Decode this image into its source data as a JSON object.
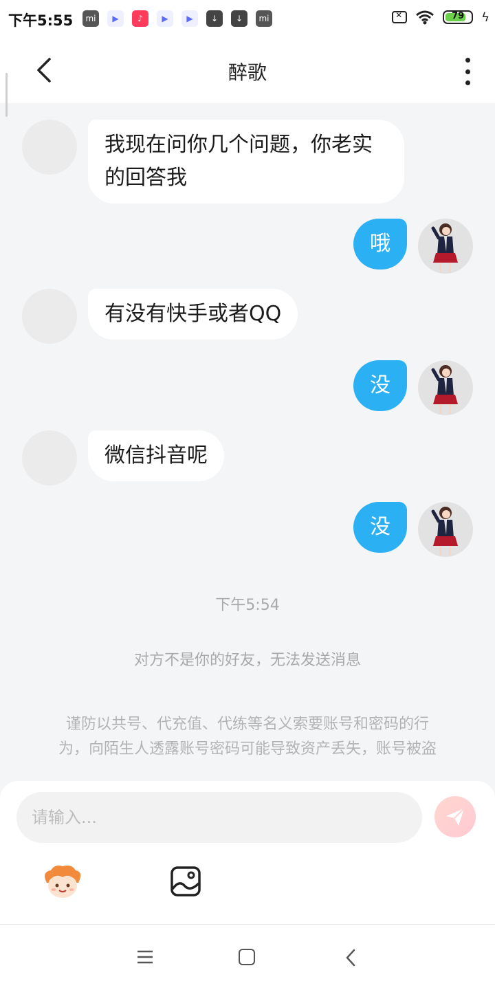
{
  "status_bar": {
    "time": "下午5:55",
    "app_icons": [
      "mi-icon",
      "video-play-icon",
      "tiktok-icon",
      "video-play-icon",
      "video-play-icon",
      "download-icon",
      "download-icon",
      "mi-icon"
    ],
    "mi_label": "mi",
    "battery_level": "79",
    "battery_fraction": 0.79
  },
  "header": {
    "title": "醉歌"
  },
  "messages": [
    {
      "side": "in",
      "text": "我现在问你几个问题，你老实的回答我"
    },
    {
      "side": "out",
      "text": "哦"
    },
    {
      "side": "in",
      "text": "有没有快手或者QQ"
    },
    {
      "side": "out",
      "text": "没"
    },
    {
      "side": "in",
      "text": "微信抖音呢"
    },
    {
      "side": "out",
      "text": "没"
    }
  ],
  "timestamp": "下午5:54",
  "system_note": "对方不是你的好友，无法发送消息",
  "warning": {
    "line1": "谨防以共号、代充值、代练等名义索要账号和密码的行",
    "line2": "为，向陌生人透露账号密码可能导致资产丢失，账号被盗"
  },
  "input": {
    "placeholder": "请输入..."
  },
  "colors": {
    "outgoing_bubble": "#2ab0f3",
    "incoming_bubble": "#ffffff",
    "chat_background": "#f4f5f7",
    "send_button": "#ffd2d2"
  }
}
